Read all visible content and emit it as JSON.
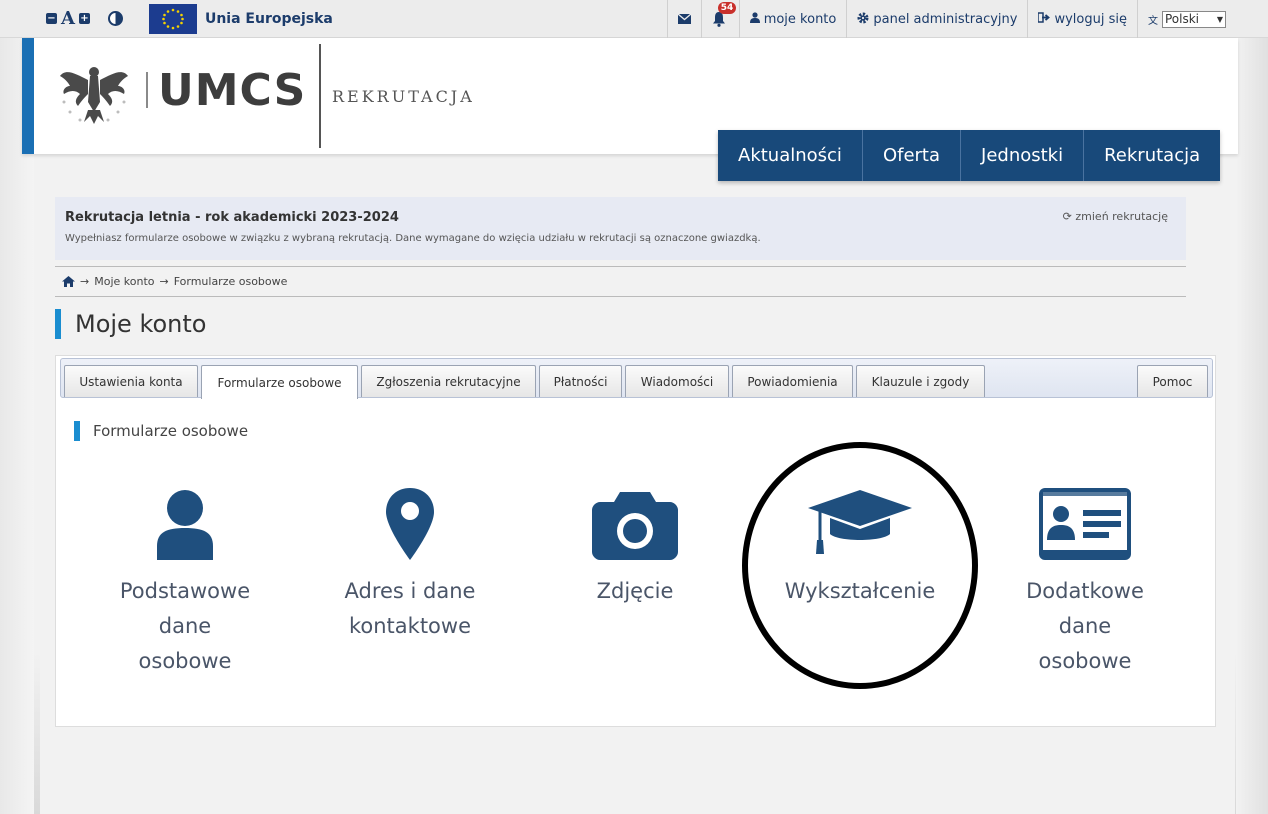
{
  "topbar": {
    "a11y_minus": "−",
    "a11y_letter": "A",
    "a11y_plus": "+",
    "eu_label": "Unia Europejska",
    "notifications_count": "54",
    "account": "moje konto",
    "admin": "panel administracyjny",
    "logout": "wyloguj się",
    "language": "Polski"
  },
  "header": {
    "logo_text": "UMCS",
    "subtitle": "REKRUTACJA"
  },
  "mainnav": {
    "items": [
      "Aktualności",
      "Oferta",
      "Jednostki",
      "Rekrutacja"
    ]
  },
  "notice": {
    "title": "Rekrutacja letnia - rok akademicki 2023-2024",
    "text": "Wypełniasz formularze osobowe w związku z wybraną rekrutacją. Dane wymagane do wzięcia udziału w rekrutacji są oznaczone gwiazdką.",
    "change_link": "zmień rekrutację"
  },
  "breadcrumb": {
    "items": [
      "Moje konto",
      "Formularze osobowe"
    ]
  },
  "page_title": "Moje konto",
  "tabs": {
    "items": [
      "Ustawienia konta",
      "Formularze osobowe",
      "Zgłoszenia rekrutacyjne",
      "Płatności",
      "Wiadomości",
      "Powiadomienia",
      "Klauzule i zgody"
    ],
    "active": "Formularze osobowe",
    "help": "Pomoc"
  },
  "section_title": "Formularze osobowe",
  "tiles": [
    {
      "icon": "user-icon",
      "lines": [
        "Podstawowe",
        "dane",
        "osobowe"
      ]
    },
    {
      "icon": "map-marker-icon",
      "lines": [
        "Adres i dane",
        "kontaktowe"
      ]
    },
    {
      "icon": "camera-icon",
      "lines": [
        "Zdjęcie"
      ]
    },
    {
      "icon": "graduation-cap-icon",
      "lines": [
        "Wykształcenie"
      ]
    },
    {
      "icon": "id-card-icon",
      "lines": [
        "Dodatkowe",
        "dane",
        "osobowe"
      ]
    }
  ],
  "colors": {
    "nav_bg": "#18497a",
    "icon": "#1f4f7e",
    "accent": "#1a8dd0"
  }
}
